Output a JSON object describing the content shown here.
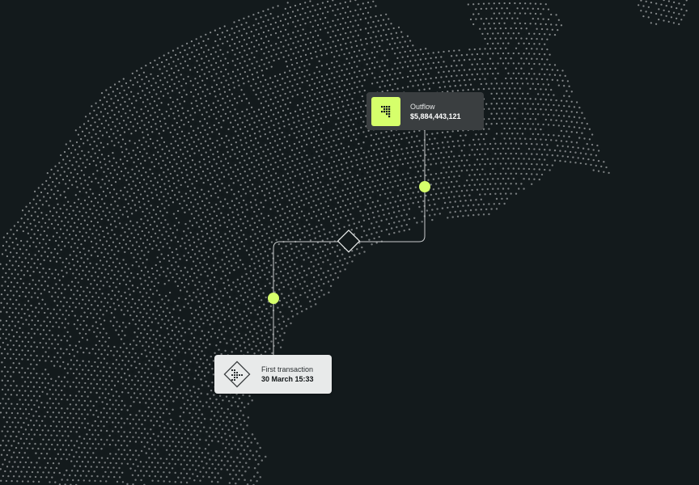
{
  "theme": {
    "background": "#131a1c",
    "dot_color": "#8a8e90",
    "accent": "#d6ff6b",
    "connector_color": "#c8cbcc"
  },
  "cards": {
    "outflow": {
      "icon": "dotted-arrow-icon",
      "label": "Outflow",
      "value": "$5,884,443,121"
    },
    "first_transaction": {
      "icon": "dotted-chevron-diamond-icon",
      "label": "First transaction",
      "value": "30 March 15:33"
    }
  }
}
